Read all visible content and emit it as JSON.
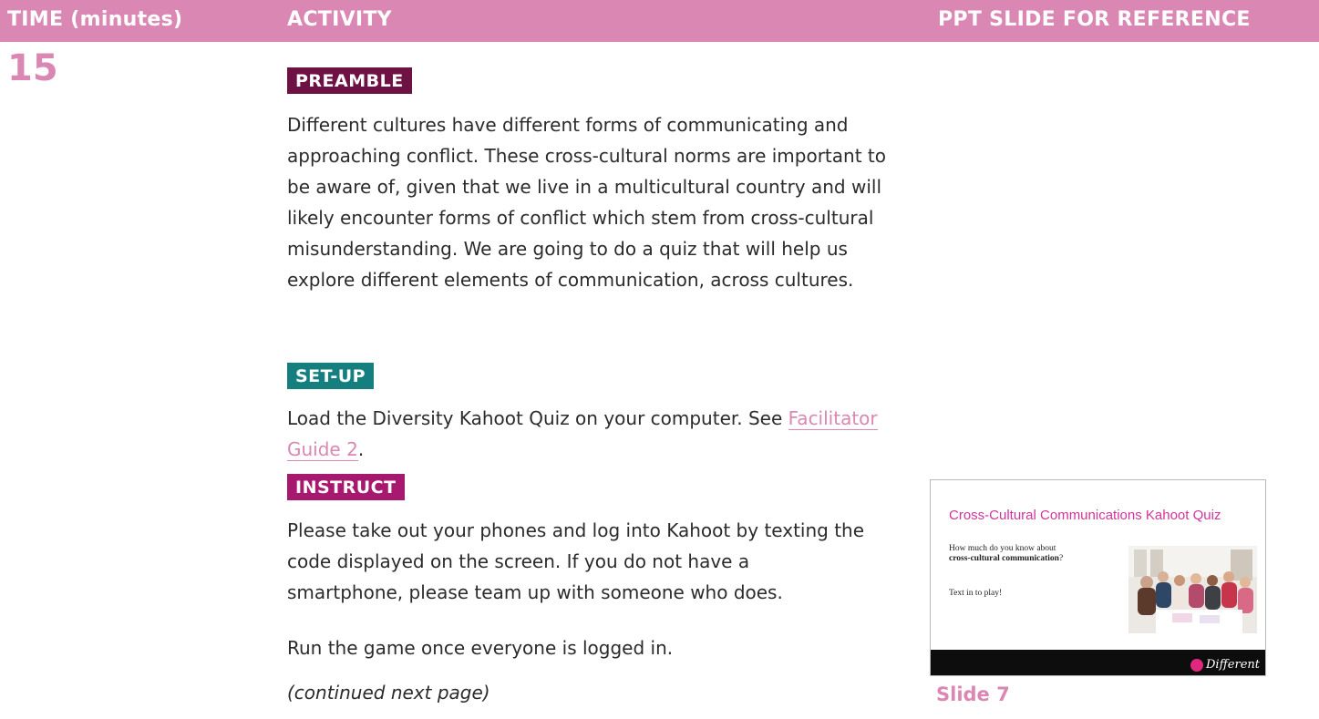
{
  "header": {
    "col_time": "TIME (minutes)",
    "col_activity": "ACTIVITY",
    "col_slide": "PPT SLIDE FOR REFERENCE"
  },
  "time_value": "15",
  "sections": {
    "preamble": {
      "label": "PREAMBLE",
      "color": "#6e1244",
      "text": "Different cultures have different forms of communicating and approaching conflict. These cross-cultural norms are important to be aware of, given that we live in a multicultural country and will likely encounter forms of conflict which stem from cross-cultural misunderstanding. We are going to do a quiz that will help us explore different elements of communication, across cultures."
    },
    "setup": {
      "label": "SET-UP",
      "color": "#157f7f",
      "text_before": "Load the Diversity Kahoot Quiz on your computer. See ",
      "link": "Facilitator Guide 2",
      "text_after": "."
    },
    "instruct": {
      "label": "INSTRUCT",
      "color": "#a7196f",
      "p1": "Please take out your phones and log into Kahoot by texting the code displayed on the screen. If you do not have a smartphone, please team up with someone who does.",
      "p2": "Run the game once everyone is logged in.",
      "p3": "(continued next page)"
    }
  },
  "slide": {
    "title": "Cross-Cultural Communications Kahoot Quiz",
    "question_prefix": "How much do you know about",
    "question_bold": "cross-cultural communication",
    "question_suffix": "?",
    "cta": "Text in to play!",
    "brand": "Different",
    "caption": "Slide 7"
  },
  "colors": {
    "header_bg": "#da87b3",
    "accent_pink": "#da87b3",
    "slide_title": "#d1359a"
  }
}
